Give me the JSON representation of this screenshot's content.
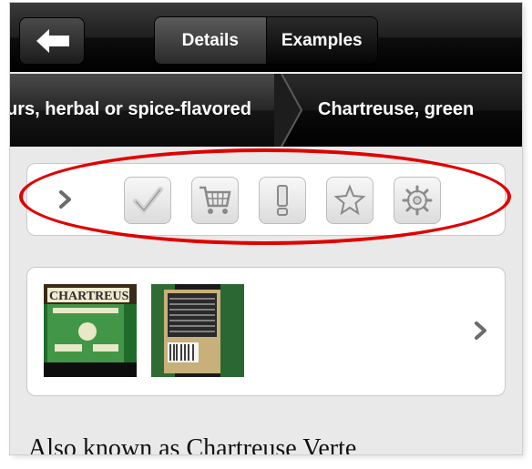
{
  "nav": {
    "back_icon": "back-arrow-icon",
    "tabs": [
      {
        "label": "Details",
        "active": true
      },
      {
        "label": "Examples",
        "active": false
      }
    ]
  },
  "breadcrumb": {
    "items": [
      "urs, herbal or spice-flavored",
      "Chartreuse, green"
    ]
  },
  "toolbar": {
    "icons": [
      "chevron-right-icon",
      "checkmark-icon",
      "cart-icon",
      "exclamation-icon",
      "star-icon",
      "gear-icon"
    ]
  },
  "gallery": {
    "images": [
      "chartreuse-bottle-front",
      "chartreuse-bottle-back"
    ],
    "more_icon": "chevron-right-icon"
  },
  "content": {
    "aka": "Also known as Chartreuse Verte"
  },
  "colors": {
    "annotation_red": "#e00000",
    "bar_dark": "#1a1a1a"
  }
}
